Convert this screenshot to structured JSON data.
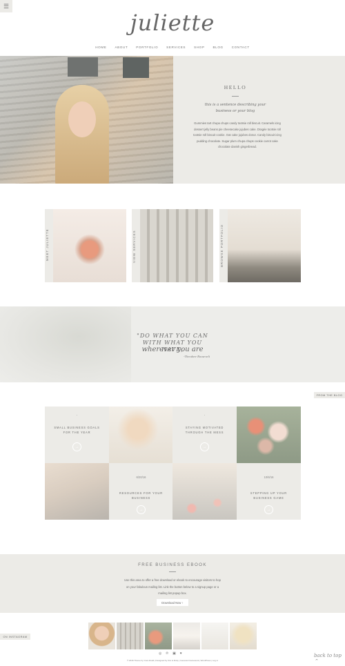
{
  "header": {
    "menu_icon": "hamburger-icon",
    "logo": "juliette",
    "nav": [
      "HOME",
      "ABOUT",
      "PORTFOLIO",
      "SERVICES",
      "SHOP",
      "BLOG",
      "CONTACT"
    ]
  },
  "hero": {
    "title": "HELLO",
    "tagline": "this is a sentence describing your business or your blog",
    "body": "Gummies tart chupa chups candy tootsie roll biscuit. Caramels icing dessert jelly beans pie cheesecake jujubes cake. Dragée tootsie roll tootsie roll biscuit cookie. Oat cake jujubes donut. Candy biscuit icing pudding chocolate. Sugar plum chupa chups cookie carrot cake chocolate danish gingerbread."
  },
  "cards": [
    {
      "label": "MEET JULIETTE"
    },
    {
      "label": "VIEW SERVICES"
    },
    {
      "label": "BROWSE PORTFOLIO"
    }
  ],
  "quote": {
    "line1": "\"DO WHAT YOU CAN",
    "line2": "WITH WHAT YOU HAVE,",
    "script": "wherever you are",
    "author": "-Theodore Roosevelt"
  },
  "blog": {
    "label": "FROM THE BLOG",
    "posts": [
      {
        "date": "-",
        "title": "SMALL BUSINESS GOALS FOR THE YEAR"
      },
      {
        "date": "-",
        "title": "STAYING MOTIVATED THROUGH THE MESS"
      },
      {
        "date": "6/20/16",
        "title": "RESOURCES FOR YOUR BUSINESS"
      },
      {
        "date": "10/6/16",
        "title": "STEPPING UP YOUR BUSINESS GAME"
      }
    ]
  },
  "ebook": {
    "title": "FREE BUSINESS EBOOK",
    "text": "Use this area to offer a free download or ebook to encourage visitors to hop on your fabulous mailing list. Link the button below to a signup page or a mailing list popup box.",
    "button": "Download Now"
  },
  "instagram": {
    "label": "ON INSTAGRAM",
    "social_icons": [
      "instagram-icon",
      "pinterest-icon",
      "facebook-icon",
      "twitter-icon"
    ]
  },
  "footer": {
    "copyright": "© 2016 Theme by Cora Dodd | Designed by Kim & Ruby | Genesis Framework | WordPress | Log in",
    "back_to_top": "back to top"
  },
  "colors": {
    "panel": "#ecebe7",
    "text": "#6b6b6b"
  }
}
